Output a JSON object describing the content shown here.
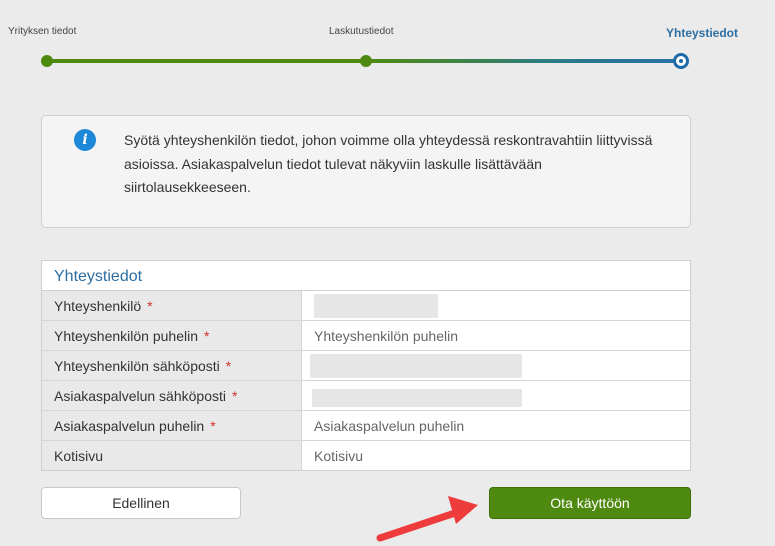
{
  "stepper": {
    "steps": [
      {
        "label": "Yrityksen tiedot",
        "state": "completed"
      },
      {
        "label": "Laskutustiedot",
        "state": "completed"
      },
      {
        "label": "Yhteystiedot",
        "state": "active"
      }
    ],
    "completed_color": "#4f8a10",
    "active_color": "#1e6aa8"
  },
  "info": {
    "icon": "info-icon",
    "text": "Syötä yhteyshenkilön tiedot, johon voimme olla yhteydessä reskontravahtiin liittyvissä asioissa. Asiakaspalvelun tiedot tulevat näkyviin laskulle lisättävään siirtolausekkeeseen."
  },
  "contact": {
    "title": "Yhteystiedot",
    "required_mark": "*",
    "fields": [
      {
        "label": "Yhteyshenkilö",
        "required": true,
        "value": "",
        "placeholder": ""
      },
      {
        "label": "Yhteyshenkilön puhelin",
        "required": true,
        "value": "",
        "placeholder": "Yhteyshenkilön puhelin"
      },
      {
        "label": "Yhteyshenkilön sähköposti",
        "required": true,
        "value": "",
        "placeholder": ""
      },
      {
        "label": "Asiakaspalvelun sähköposti",
        "required": true,
        "value": "",
        "placeholder": ""
      },
      {
        "label": "Asiakaspalvelun puhelin",
        "required": true,
        "value": "",
        "placeholder": "Asiakaspalvelun puhelin"
      },
      {
        "label": "Kotisivu",
        "required": false,
        "value": "",
        "placeholder": "Kotisivu"
      }
    ]
  },
  "actions": {
    "previous_label": "Edellinen",
    "submit_label": "Ota käyttöön",
    "submit_color": "#4f8a10"
  },
  "annotation": {
    "arrow_color": "#ee3b3b"
  }
}
